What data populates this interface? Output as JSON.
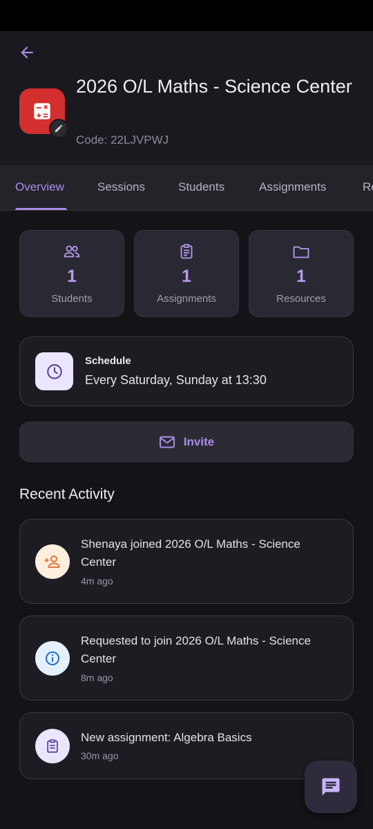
{
  "header": {
    "title": "2026 O/L Maths - Science Center",
    "code": "Code: 22LJVPWJ"
  },
  "tabs": [
    {
      "label": "Overview",
      "active": true
    },
    {
      "label": "Sessions",
      "active": false
    },
    {
      "label": "Students",
      "active": false
    },
    {
      "label": "Assignments",
      "active": false
    },
    {
      "label": "Re",
      "active": false
    }
  ],
  "stats": [
    {
      "icon": "people-icon",
      "value": "1",
      "label": "Students"
    },
    {
      "icon": "clipboard-icon",
      "value": "1",
      "label": "Assignments"
    },
    {
      "icon": "folder-icon",
      "value": "1",
      "label": "Resources"
    }
  ],
  "schedule": {
    "title": "Schedule",
    "text": "Every Saturday, Sunday at 13:30"
  },
  "invite": {
    "label": "Invite"
  },
  "recent_activity": {
    "title": "Recent Activity",
    "items": [
      {
        "icon": "person-add-icon",
        "text": "Shenaya joined 2026 O/L Maths - Science Center",
        "time": "4m ago"
      },
      {
        "icon": "info-icon",
        "text": "Requested to join 2026 O/L Maths - Science Center",
        "time": "8m ago"
      },
      {
        "icon": "assignment-icon",
        "text": "New assignment: Algebra Basics",
        "time": "30m ago"
      }
    ]
  },
  "colors": {
    "accent": "#a98ce8",
    "class_icon_bg": "#d32f2f",
    "background": "#141318"
  }
}
